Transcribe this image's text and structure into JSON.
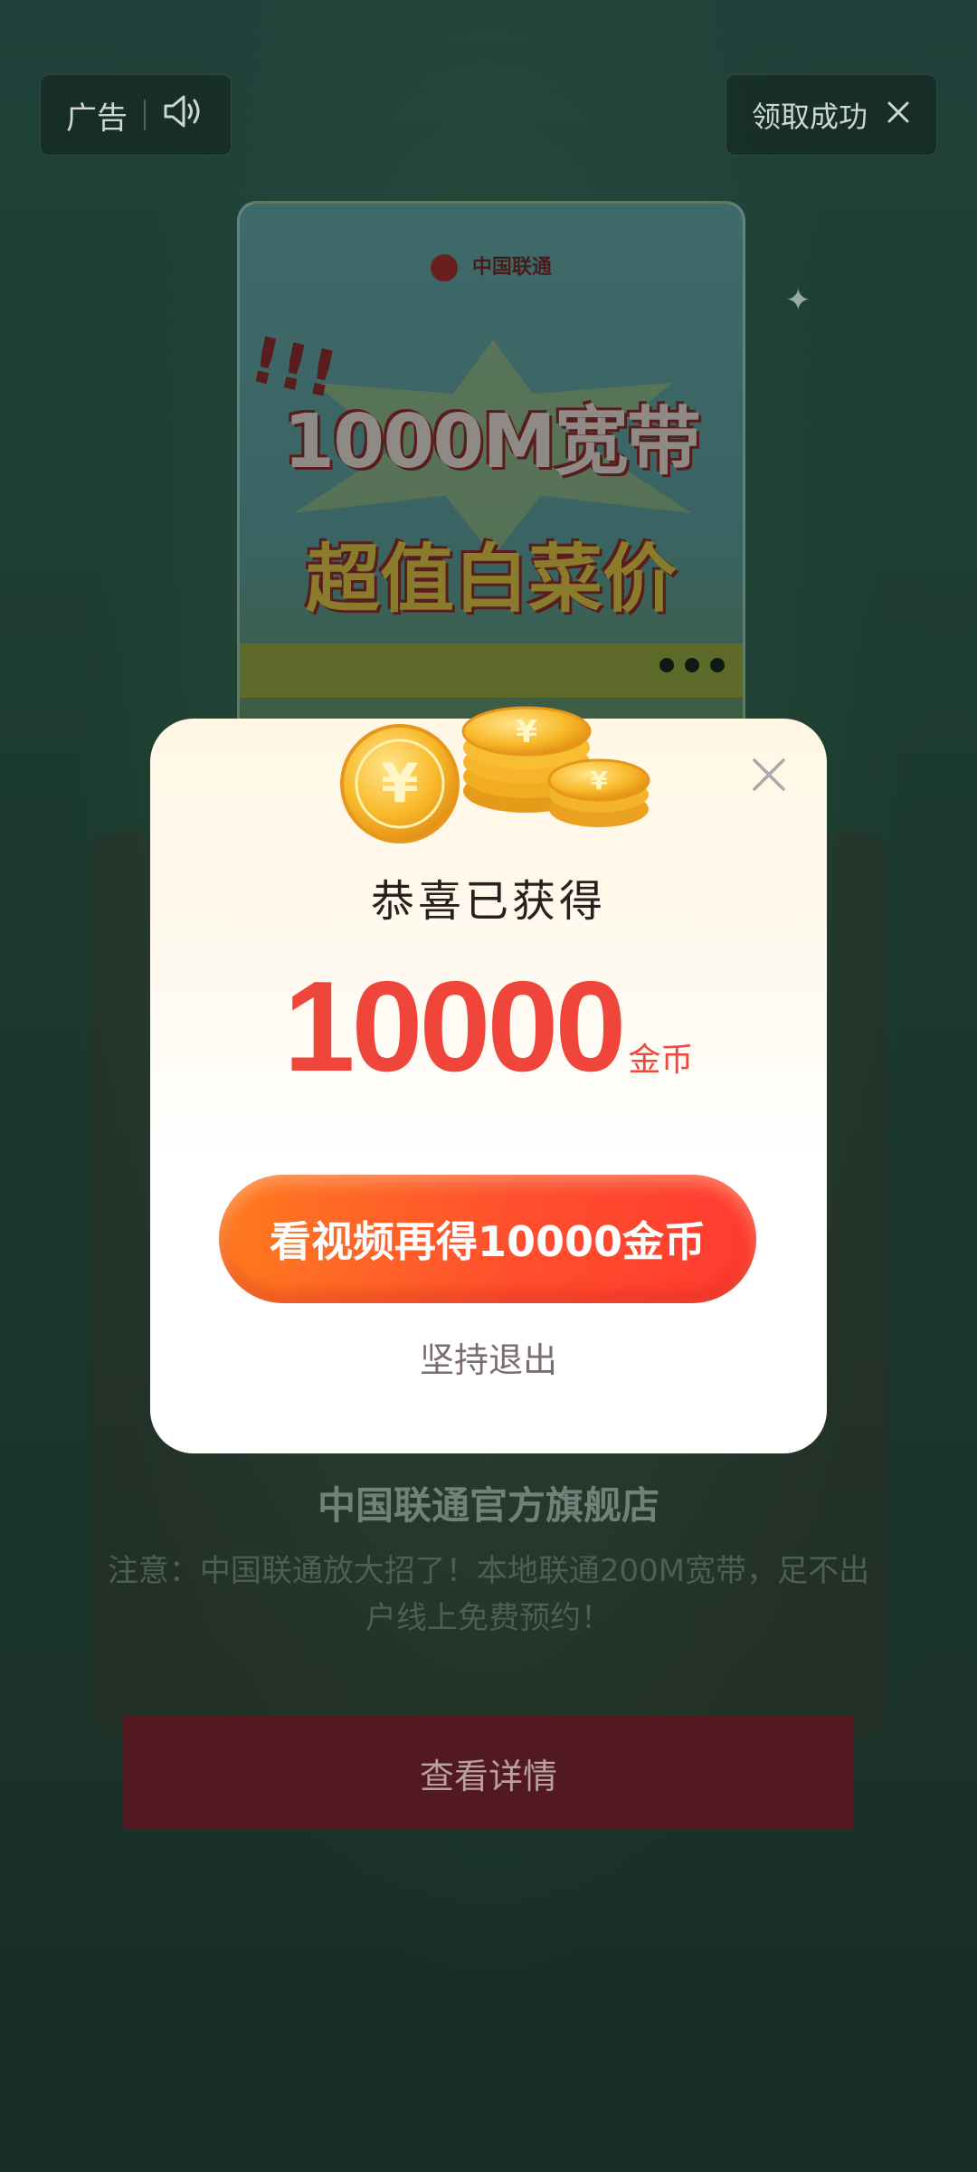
{
  "top_left": {
    "ad_label": "广告",
    "sound_icon": "speaker-icon"
  },
  "top_right": {
    "status": "领取成功",
    "close_icon": "close-icon"
  },
  "ad_card": {
    "brand": "中国联通",
    "headline": "1000M宽带",
    "subline": "超值白菜价"
  },
  "store": {
    "name": "中国联通官方旗舰店",
    "description": "注意：中国联通放大招了！本地联通200M宽带，足不出户线上免费预约！",
    "detail_button": "查看详情"
  },
  "modal": {
    "title": "恭喜已获得",
    "amount": "10000",
    "unit": "金币",
    "watch_button": "看视频再得10000金币",
    "quit_link": "坚持退出",
    "close_icon": "close-icon",
    "coins_icon": "gold-coins-icon"
  },
  "colors": {
    "accent_red": "#f0453a",
    "button_start": "#ff7a1f",
    "button_end": "#ff3b2f"
  }
}
